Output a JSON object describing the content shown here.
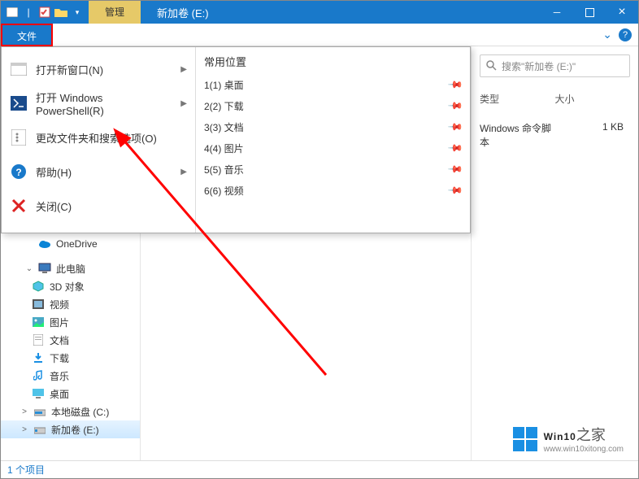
{
  "titlebar": {
    "manage": "管理",
    "title": "新加卷 (E:)"
  },
  "ribbon": {
    "file": "文件"
  },
  "file_menu": {
    "items": [
      {
        "label": "打开新窗口(N)",
        "arrow": true,
        "icon": "window"
      },
      {
        "label": "打开 Windows PowerShell(R)",
        "arrow": true,
        "icon": "powershell"
      },
      {
        "label": "更改文件夹和搜索选项(O)",
        "arrow": false,
        "icon": "options"
      },
      {
        "label": "帮助(H)",
        "arrow": true,
        "icon": "help"
      },
      {
        "label": "关闭(C)",
        "arrow": false,
        "icon": "close"
      }
    ],
    "locations_header": "常用位置",
    "locations": [
      {
        "label": "1(1) 桌面"
      },
      {
        "label": "2(2) 下载"
      },
      {
        "label": "3(3) 文档"
      },
      {
        "label": "4(4) 图片"
      },
      {
        "label": "5(5) 音乐"
      },
      {
        "label": "6(6) 视频"
      }
    ]
  },
  "search": {
    "placeholder": "搜索\"新加卷 (E:)\""
  },
  "columns": {
    "type": "类型",
    "size": "大小"
  },
  "file": {
    "type": "Windows 命令脚本",
    "size": "1 KB"
  },
  "tree": [
    {
      "label": "OneDrive",
      "indent": "i1",
      "icon": "cloud"
    },
    {
      "label": "此电脑",
      "indent": "i1",
      "icon": "pc",
      "exp": "⌄"
    },
    {
      "label": "3D 对象",
      "indent": "i2",
      "icon": "3d"
    },
    {
      "label": "视频",
      "indent": "i2",
      "icon": "video"
    },
    {
      "label": "图片",
      "indent": "i2",
      "icon": "pic"
    },
    {
      "label": "文档",
      "indent": "i2",
      "icon": "doc"
    },
    {
      "label": "下载",
      "indent": "i2",
      "icon": "dl"
    },
    {
      "label": "音乐",
      "indent": "i2",
      "icon": "music"
    },
    {
      "label": "桌面",
      "indent": "i2",
      "icon": "desk"
    },
    {
      "label": "本地磁盘 (C:)",
      "indent": "i2",
      "icon": "disk",
      "exp": ">"
    },
    {
      "label": "新加卷 (E:)",
      "indent": "i2",
      "icon": "disk",
      "sel": true,
      "exp": ">"
    }
  ],
  "status": {
    "text": "1 个项目"
  },
  "watermark": {
    "brand": "Win10",
    "suffix": "之家",
    "url": "www.win10xitong.com"
  }
}
